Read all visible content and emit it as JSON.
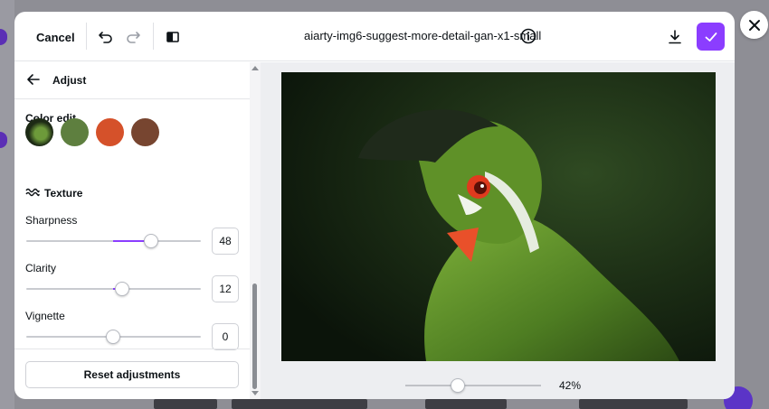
{
  "header": {
    "cancel_label": "Cancel",
    "file_title": "aiarty-img6-suggest-more-detail-gan-x1-small",
    "icons": [
      "undo-icon",
      "redo-icon",
      "compare-icon",
      "info-icon",
      "download-icon",
      "check-icon",
      "close-icon"
    ]
  },
  "panel": {
    "title": "Adjust",
    "color_edit_label": "Color edit",
    "swatches": [
      "#5e7f3f",
      "#d5512a",
      "#774530"
    ],
    "texture_label": "Texture",
    "sliders": [
      {
        "label": "Sharpness",
        "value": "48"
      },
      {
        "label": "Clarity",
        "value": "12"
      },
      {
        "label": "Vignette",
        "value": "0"
      }
    ],
    "reset_label": "Reset adjustments"
  },
  "preview": {
    "zoom_value": "42%"
  },
  "colors": {
    "accent": "#8b3dff"
  }
}
